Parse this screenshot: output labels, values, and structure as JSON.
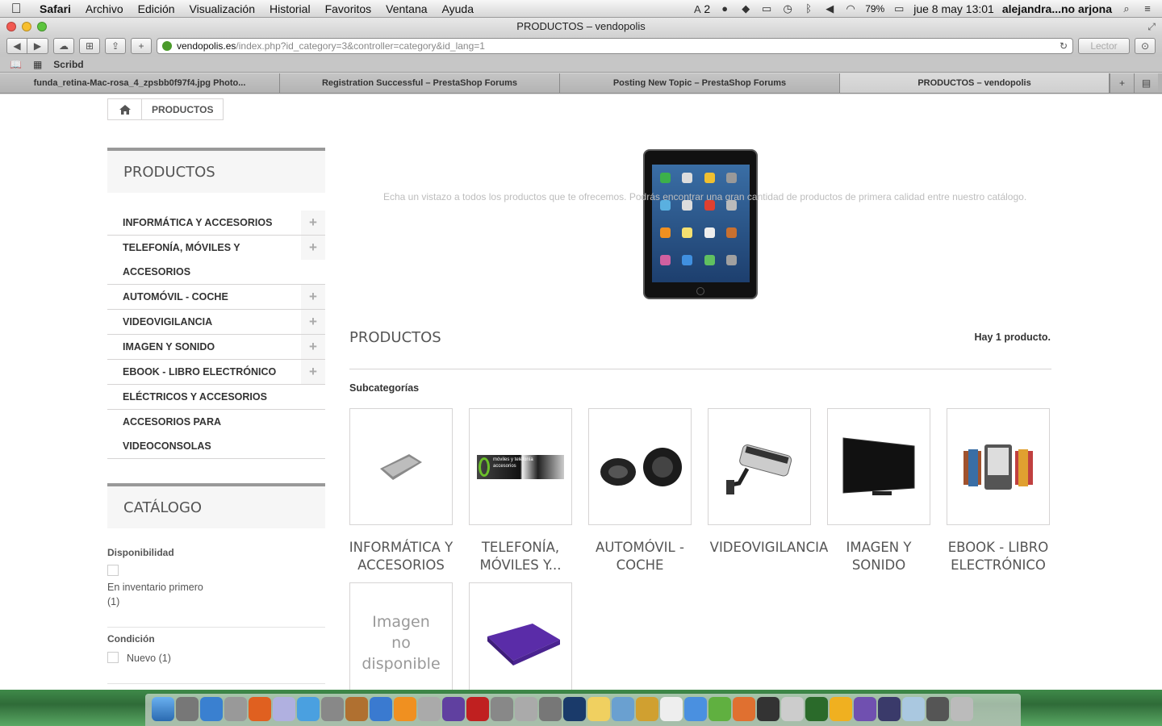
{
  "menubar": {
    "apple": "",
    "items": [
      "Safari",
      "Archivo",
      "Edición",
      "Visualización",
      "Historial",
      "Favoritos",
      "Ventana",
      "Ayuda"
    ],
    "status": {
      "input_badge": "2",
      "battery": "79%",
      "clock": "jue 8 may  13:01",
      "user": "alejandra...no arjona"
    }
  },
  "window": {
    "title": "PRODUCTOS – vendopolis"
  },
  "toolbar": {
    "url_domain": "vendopolis.es",
    "url_path": "/index.php?id_category=3&controller=category&id_lang=1",
    "reader_label": "Lector"
  },
  "bookmarks": {
    "items": [
      "Scribd"
    ]
  },
  "tabs": [
    {
      "label": "funda_retina-Mac-rosa_4_zpsbb0f97f4.jpg Photo..."
    },
    {
      "label": "Registration Successful – PrestaShop Forums"
    },
    {
      "label": "Posting New Topic – PrestaShop Forums"
    },
    {
      "label": "PRODUCTOS – vendopolis"
    }
  ],
  "breadcrumb": {
    "current": "PRODUCTOS"
  },
  "sidebar": {
    "products_title": "PRODUCTOS",
    "categories": [
      {
        "label": "INFORMÁTICA Y ACCESORIOS",
        "expandable": true
      },
      {
        "label": "TELEFONÍA, MÓVILES Y ACCESORIOS",
        "expandable": true
      },
      {
        "label": "AUTOMÓVIL - COCHE",
        "expandable": true
      },
      {
        "label": "VIDEOVIGILANCIA",
        "expandable": true
      },
      {
        "label": "IMAGEN Y SONIDO",
        "expandable": true
      },
      {
        "label": "EBOOK - LIBRO ELECTRÓNICO",
        "expandable": true
      },
      {
        "label": "ELÉCTRICOS Y ACCESORIOS",
        "expandable": false
      },
      {
        "label": "ACCESORIOS PARA VIDEOCONSOLAS",
        "expandable": false
      }
    ],
    "catalog_title": "CATÁLOGO",
    "filters": {
      "availability_label": "Disponibilidad",
      "availability_option": "En inventario primero",
      "availability_count": "(1)",
      "condition_label": "Condición",
      "condition_option": "Nuevo (1)"
    }
  },
  "content": {
    "description": "Echa un vistazo a todos los productos que te ofrecemos. Podrás encontrar una gran cantidad de productos de primera calidad entre nuestro catálogo.",
    "heading": "PRODUCTOS",
    "product_count": "Hay 1 producto.",
    "subcategories_title": "Subcategorías",
    "subcategories": [
      {
        "name": "INFORMÁTICA Y ACCESORIOS"
      },
      {
        "name": "TELEFONÍA, MÓVILES Y..."
      },
      {
        "name": "AUTOMÓVIL - COCHE"
      },
      {
        "name": "VIDEOVIGILANCIA"
      },
      {
        "name": "IMAGEN Y SONIDO"
      },
      {
        "name": "EBOOK - LIBRO ELECTRÓNICO"
      }
    ],
    "no_image_text": "Imagen no disponible",
    "phone_logo_text": "móviles y telefonía accesorios"
  },
  "colors": {
    "accent_rule": "#999999",
    "border": "#d6d4d4",
    "heading": "#555555"
  }
}
